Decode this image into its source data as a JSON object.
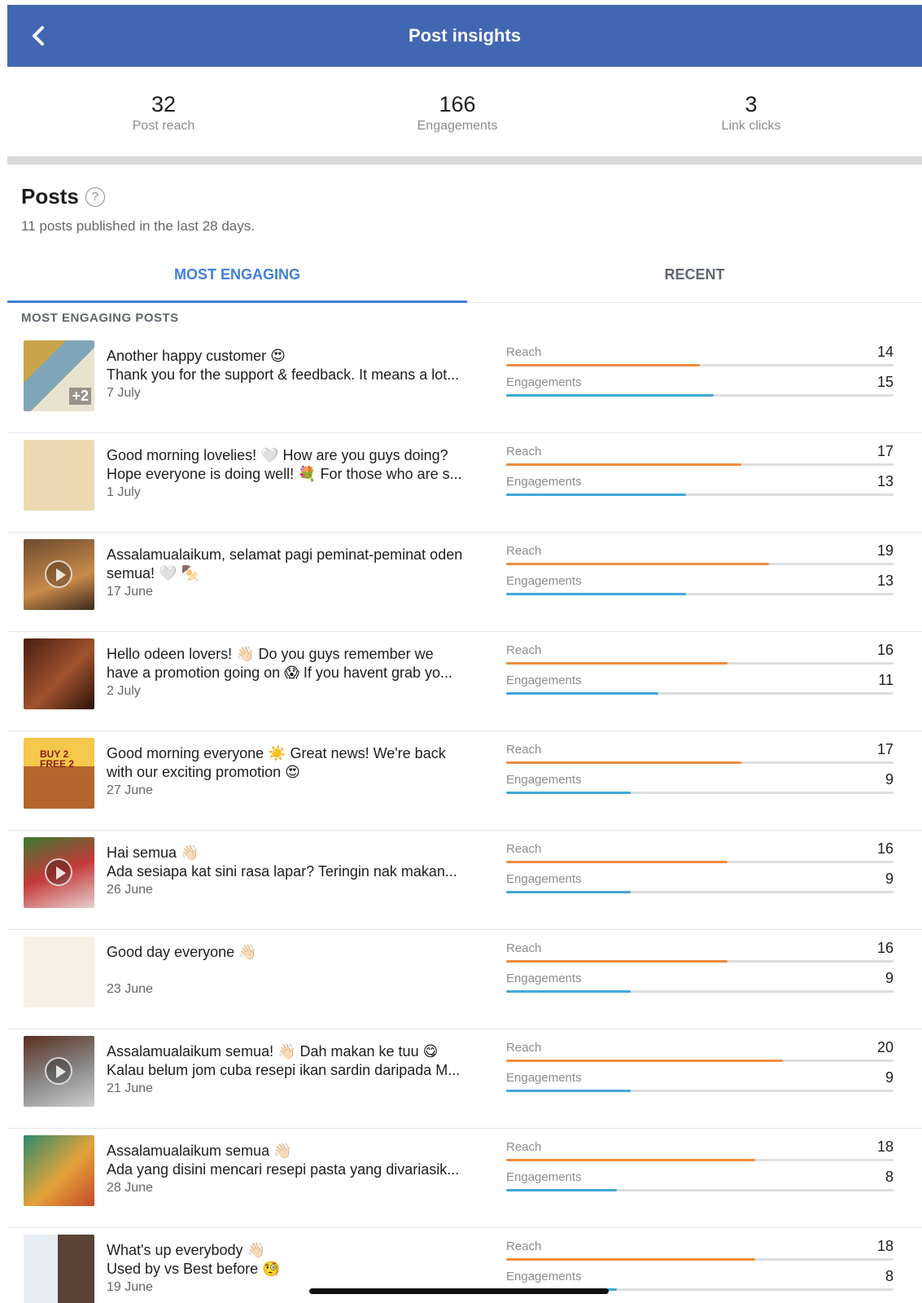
{
  "header": {
    "title": "Post insights"
  },
  "stats": [
    {
      "value": "32",
      "label": "Post reach"
    },
    {
      "value": "166",
      "label": "Engagements"
    },
    {
      "value": "3",
      "label": "Link clicks"
    }
  ],
  "posts_section": {
    "title": "Posts",
    "help": "?",
    "subtitle": "11 posts published in the last 28 days."
  },
  "tabs": [
    {
      "label": "MOST ENGAGING",
      "active": true
    },
    {
      "label": "RECENT",
      "active": false
    }
  ],
  "list_label": "MOST ENGAGING POSTS",
  "metric_labels": {
    "reach": "Reach",
    "engagements": "Engagements"
  },
  "colors": {
    "header": "#4267b2",
    "tab_active": "#4080d8",
    "reach_bar": "#f08c3c",
    "engagement_bar": "#3ea8d8"
  },
  "posts": [
    {
      "line1": "Another happy customer 😍",
      "line2": "Thank you for the support & feedback. It means a lot...",
      "date": "7 July",
      "reach": 14,
      "engagements": 15,
      "thumb": "review",
      "extra": "+2"
    },
    {
      "line1": "Good morning lovelies! 🤍 How are you guys doing?",
      "line2": "Hope everyone is doing well! 💐 For those who are s...",
      "date": "1 July",
      "reach": 17,
      "engagements": 13,
      "thumb": "quote"
    },
    {
      "line1": "Assalamualaikum, selamat pagi peminat-peminat oden",
      "line2": "semua! 🤍 🍢",
      "date": "17 June",
      "reach": 19,
      "engagements": 13,
      "thumb": "video"
    },
    {
      "line1": "Hello odeen lovers! 👋🏻 Do you guys remember we",
      "line2": "have a promotion going on 😱 If you havent grab yo...",
      "date": "2 July",
      "reach": 16,
      "engagements": 11,
      "thumb": "promo-dark"
    },
    {
      "line1": "Good morning everyone ☀️ Great news! We're back",
      "line2": "with our exciting promotion 😍",
      "date": "27 June",
      "reach": 17,
      "engagements": 9,
      "thumb": "buy2free2",
      "promo_text": "BUY 2 FREE 2"
    },
    {
      "line1": "Hai semua 👋🏻",
      "line2": "Ada sesiapa kat sini rasa lapar? Teringin nak makan...",
      "date": "26 June",
      "reach": 16,
      "engagements": 9,
      "thumb": "video-food"
    },
    {
      "line1": "Good day everyone 👋🏻",
      "line2": "",
      "date": "23 June",
      "reach": 16,
      "engagements": 9,
      "thumb": "menu"
    },
    {
      "line1": "Assalamualaikum semua! 👋🏻 Dah makan ke tuu 😋",
      "line2": "Kalau belum jom cuba resepi ikan sardin daripada M...",
      "date": "21 June",
      "reach": 20,
      "engagements": 9,
      "thumb": "video-cook"
    },
    {
      "line1": "Assalamualaikum semua 👋🏻",
      "line2": "Ada yang disini mencari resepi pasta yang divariasik...",
      "date": "28 June",
      "reach": 18,
      "engagements": 8,
      "thumb": "pasta"
    },
    {
      "line1": "What's up everybody 👋🏻",
      "line2": "Used by vs Best before 🧐",
      "date": "19 June",
      "reach": 18,
      "engagements": 8,
      "thumb": "info"
    }
  ]
}
